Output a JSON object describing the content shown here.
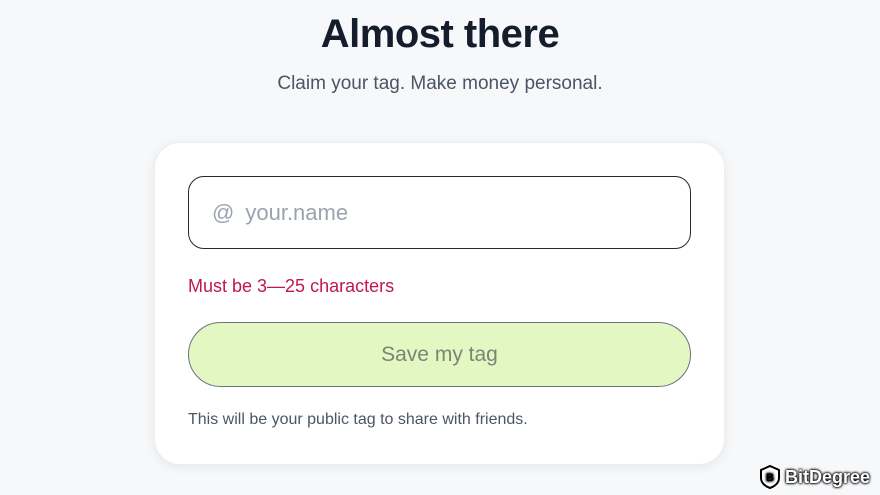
{
  "page": {
    "title": "Almost there",
    "subtitle": "Claim your tag. Make money personal."
  },
  "form": {
    "at_symbol": "@",
    "tag_input": {
      "value": "",
      "placeholder": "your.name"
    },
    "error_text": "Must be 3—25 characters",
    "save_label": "Save my tag",
    "hint_text": "This will be your public tag to share with friends."
  },
  "watermark": {
    "logo_icon": "bitdegree-logo-icon",
    "text": "BitDegree"
  },
  "colors": {
    "background": "#f7f8fa",
    "error": "#c0184a",
    "button_bg": "#e3f7c2",
    "button_text": "#7a8577"
  }
}
